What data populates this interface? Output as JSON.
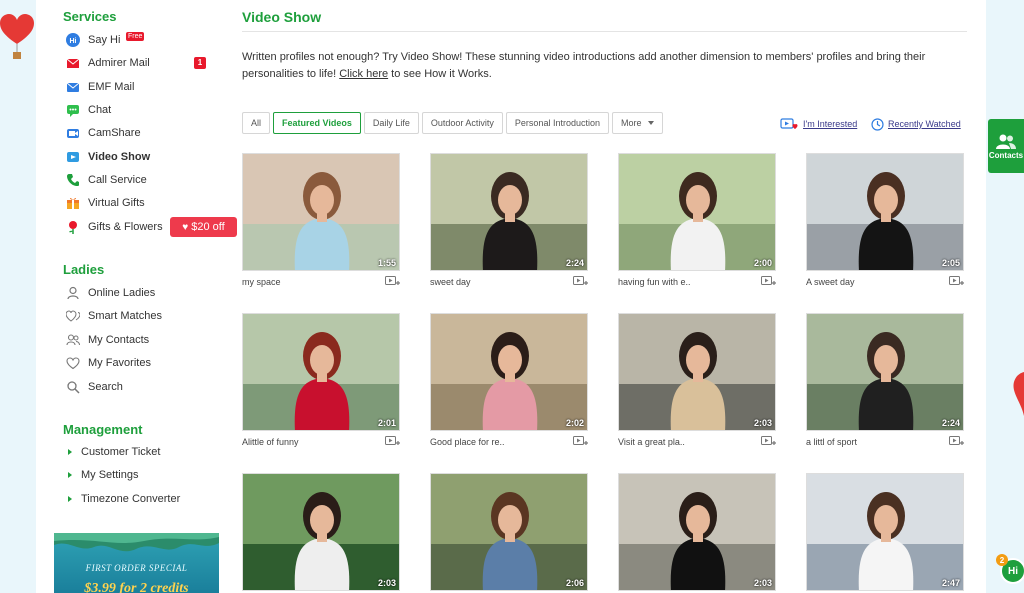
{
  "sidebar": {
    "services_title": "Services",
    "services": [
      {
        "label": "Say Hi",
        "icon": "say-hi-icon",
        "badge": "Free"
      },
      {
        "label": "Admirer Mail",
        "icon": "admirer-mail-icon",
        "badge": "1"
      },
      {
        "label": "EMF Mail",
        "icon": "mail-icon"
      },
      {
        "label": "Chat",
        "icon": "chat-bubble-icon"
      },
      {
        "label": "CamShare",
        "icon": "camera-icon"
      },
      {
        "label": "Video Show",
        "icon": "play-icon"
      },
      {
        "label": "Call Service",
        "icon": "phone-icon"
      },
      {
        "label": "Virtual Gifts",
        "icon": "gift-icon"
      },
      {
        "label": "Gifts & Flowers",
        "icon": "rose-icon",
        "badge": "$20 off"
      }
    ],
    "ladies_title": "Ladies",
    "ladies": [
      {
        "label": "Online Ladies",
        "icon": "person-icon"
      },
      {
        "label": "Smart Matches",
        "icon": "hearts-icon"
      },
      {
        "label": "My Contacts",
        "icon": "contacts-icon"
      },
      {
        "label": "My Favorites",
        "icon": "heart-outline-icon"
      },
      {
        "label": "Search",
        "icon": "search-icon"
      }
    ],
    "management_title": "Management",
    "management": [
      {
        "label": "Customer Ticket"
      },
      {
        "label": "My Settings"
      },
      {
        "label": "Timezone Converter"
      }
    ],
    "promo": {
      "line1": "FIRST ORDER SPECIAL",
      "line2": "$3.99 for 2 credits"
    }
  },
  "main": {
    "title": "Video Show",
    "intro_text": "Written profiles not enough? Try Video Show! These stunning video introductions add another dimension to members' profiles and bring their personalities to life! ",
    "intro_link": "Click here",
    "intro_after": " to see How it Works.",
    "tabs": [
      "All",
      "Featured Videos",
      "Daily Life",
      "Outdoor Activity",
      "Personal Introduction",
      "More"
    ],
    "active_tab": "Featured Videos",
    "link_interested": "I'm Interested",
    "link_recent": "Recently Watched",
    "videos": [
      {
        "caption": "my space",
        "duration": "1:55"
      },
      {
        "caption": "sweet day",
        "duration": "2:24"
      },
      {
        "caption": "having fun with e..",
        "duration": "2:00"
      },
      {
        "caption": "A sweet day",
        "duration": "2:05"
      },
      {
        "caption": "Alittle of funny",
        "duration": "2:01"
      },
      {
        "caption": "Good place for re..",
        "duration": "2:02"
      },
      {
        "caption": "Visit a great pla..",
        "duration": "2:03"
      },
      {
        "caption": "a littl of sport",
        "duration": "2:24"
      },
      {
        "caption": "",
        "duration": "2:03"
      },
      {
        "caption": "",
        "duration": "2:06"
      },
      {
        "caption": "",
        "duration": "2:03"
      },
      {
        "caption": "",
        "duration": "2:47"
      }
    ]
  },
  "widgets": {
    "contacts_label": "Contacts",
    "hi_label": "Hi",
    "hi_count": "2"
  },
  "colors": {
    "accent_green": "#1e9f3c",
    "badge_red": "#e8192c",
    "page_bg": "#e9f6fb"
  }
}
